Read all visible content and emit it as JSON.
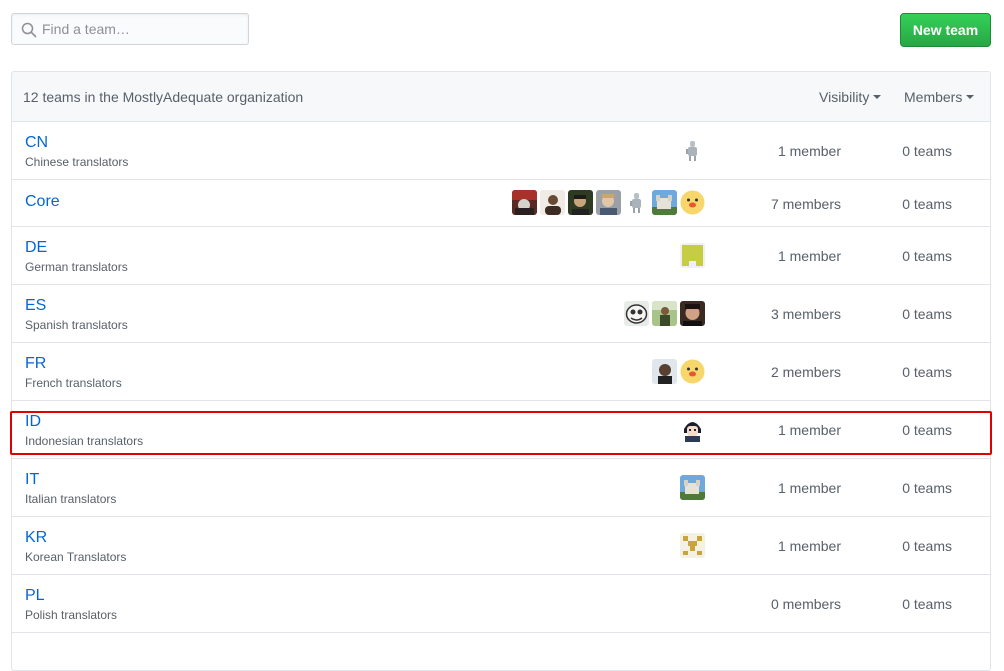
{
  "search": {
    "placeholder": "Find a team…",
    "value": ""
  },
  "new_team_label": "New team",
  "header": {
    "summary": "12 teams in the MostlyAdequate organization",
    "visibility_label": "Visibility",
    "members_label": "Members"
  },
  "teams": [
    {
      "name": "CN",
      "description": "Chinese translators",
      "members": "1 member",
      "teams": "0 teams",
      "avatars": [
        "robot"
      ]
    },
    {
      "name": "Core",
      "description": "",
      "members": "7 members",
      "teams": "0 teams",
      "avatars": [
        "photo-red",
        "person-light",
        "person-dark",
        "person-gray",
        "robot",
        "castle",
        "chick"
      ]
    },
    {
      "name": "DE",
      "description": "German translators",
      "members": "1 member",
      "teams": "0 teams",
      "avatars": [
        "identicon-green"
      ]
    },
    {
      "name": "ES",
      "description": "Spanish translators",
      "members": "3 members",
      "teams": "0 teams",
      "avatars": [
        "cartoon-face",
        "outdoor-person",
        "person-dark2"
      ]
    },
    {
      "name": "FR",
      "description": "French translators",
      "members": "2 members",
      "teams": "0 teams",
      "avatars": [
        "person-side",
        "chick"
      ]
    },
    {
      "name": "ID",
      "description": "Indonesian translators",
      "members": "1 member",
      "teams": "0 teams",
      "avatars": [
        "anime"
      ]
    },
    {
      "name": "IT",
      "description": "Italian translators",
      "members": "1 member",
      "teams": "0 teams",
      "avatars": [
        "castle"
      ]
    },
    {
      "name": "KR",
      "description": "Korean Translators",
      "members": "1 member",
      "teams": "0 teams",
      "avatars": [
        "identicon-gold"
      ]
    },
    {
      "name": "PL",
      "description": "Polish translators",
      "members": "0 members",
      "teams": "0 teams",
      "avatars": []
    }
  ],
  "colors": {
    "link": "#0366d6",
    "primary_button": "#28a745",
    "highlight": "#e00000"
  }
}
